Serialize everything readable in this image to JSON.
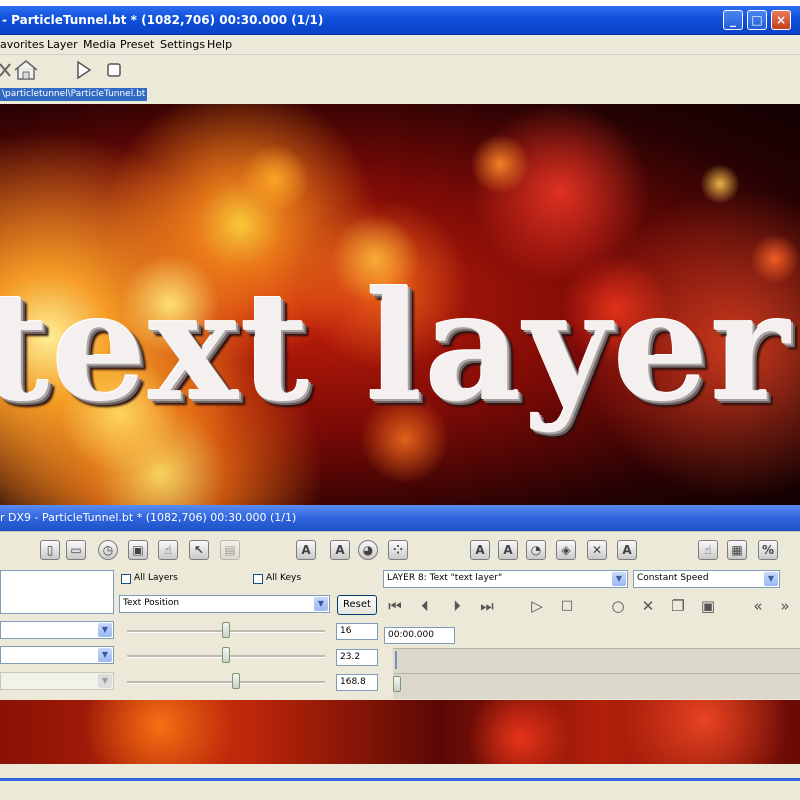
{
  "window": {
    "title": "- ParticleTunnel.bt * (1082,706) 00:30.000 (1/1)",
    "controls": [
      "_",
      "□",
      "×"
    ]
  },
  "menu": [
    "avorites",
    "Layer",
    "Media",
    "Preset",
    "Settings",
    "Help"
  ],
  "toolbar": {
    "path": "\\particletunnel\\ParticleTunnel.bt"
  },
  "preview": {
    "text": "text layer"
  },
  "editor": {
    "title": "r DX9 - ParticleTunnel.bt * (1082,706) 00:30.000 (1/1)",
    "all_layers_label": "All Layers",
    "all_keys_label": "All Keys",
    "property_select": "Text Position",
    "reset_label": "Reset",
    "layer_select": "LAYER 8: Text \"text layer\"",
    "speed_select": "Constant Speed",
    "value1": "16",
    "value2": "23.2",
    "value3": "168.8",
    "time": "00:00.000",
    "sliders": [
      0.5,
      0.5,
      0.55
    ]
  },
  "colors": {
    "title_blue": "#0f50dc",
    "panel": "#ece9d8",
    "selection": "#316ac5"
  }
}
